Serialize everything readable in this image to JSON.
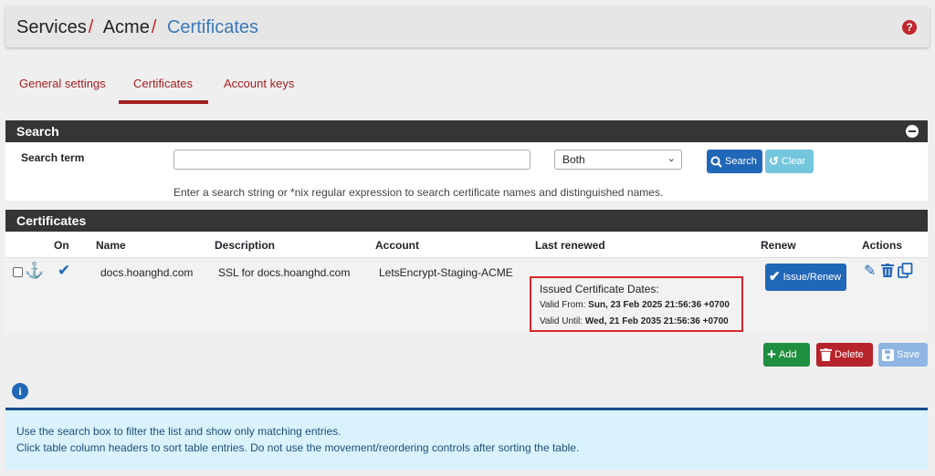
{
  "breadcrumb": {
    "items": [
      "Services",
      "Acme",
      "Certificates"
    ],
    "separator": "/"
  },
  "tabs": [
    {
      "label": "General settings",
      "active": false
    },
    {
      "label": "Certificates",
      "active": true
    },
    {
      "label": "Account keys",
      "active": false
    }
  ],
  "search_panel": {
    "title": "Search",
    "term_label": "Search term",
    "term_value": "",
    "scope_value": "Both",
    "search_button": "Search",
    "clear_button": "Clear",
    "help_text": "Enter a search string or *nix regular expression to search certificate names and distinguished names."
  },
  "certificates_panel": {
    "title": "Certificates",
    "columns": [
      "On",
      "Name",
      "Description",
      "Account",
      "Last renewed",
      "Renew",
      "Actions"
    ],
    "rows": [
      {
        "checked": false,
        "on": true,
        "name": "docs.hoanghd.com",
        "description": "SSL for docs.hoanghd.com",
        "account": "LetsEncrypt-Staging-ACME",
        "last_renewed": {
          "title": "Issued Certificate Dates:",
          "valid_from_label": "Valid From:",
          "valid_from": "Sun, 23 Feb 2025 21:56:36 +0700",
          "valid_until_label": "Valid Until:",
          "valid_until": "Wed, 21 Feb 2035 21:56:36 +0700"
        },
        "renew_button": "Issue/Renew"
      }
    ]
  },
  "actions": {
    "add": "Add",
    "delete": "Delete",
    "save": "Save"
  },
  "info": {
    "line1": "Use the search box to filter the list and show only matching entries.",
    "line2": "Click table column headers to sort table entries. Do not use the movement/reordering controls after sorting the table."
  },
  "colors": {
    "accent": "#2167b8",
    "tab_active": "#a52020",
    "panel_heading": "#353535",
    "highlight_box": "#d8262c"
  },
  "icons": [
    "help-icon",
    "collapse-icon",
    "search-icon",
    "clear-icon",
    "anchor-icon",
    "check-icon",
    "edit-icon",
    "trash-icon",
    "copy-icon",
    "plus-icon",
    "info-icon"
  ]
}
